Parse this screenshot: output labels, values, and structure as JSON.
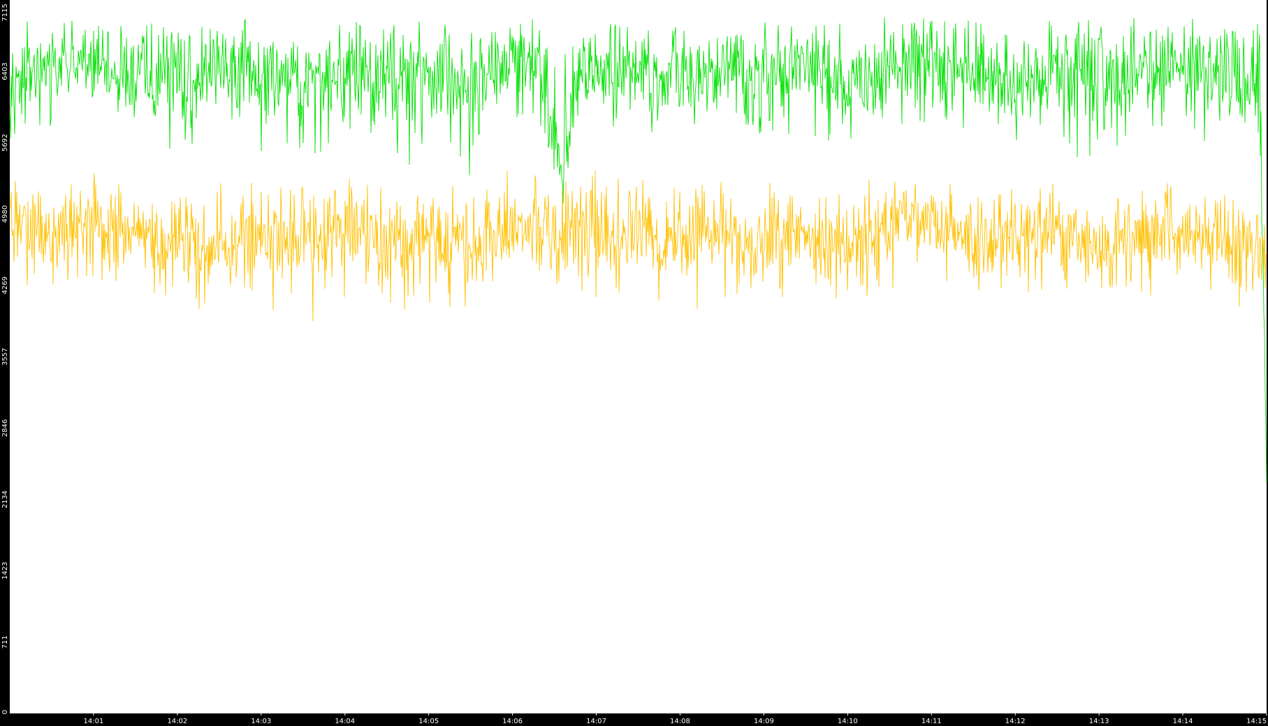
{
  "chart_data": {
    "type": "line",
    "title": "",
    "xlabel": "",
    "ylabel": "",
    "ylim": [
      0,
      7115
    ],
    "xlim": [
      "14:00:00",
      "14:15:00"
    ],
    "grid": false,
    "legend": "none",
    "colors": {
      "background": "#000000",
      "plot_area": "#ffffff",
      "axis_text": "#ffffff"
    },
    "y_ticks": [
      "0",
      "711",
      "1423",
      "2134",
      "2846",
      "3557",
      "4269",
      "4980",
      "5692",
      "6403",
      "7115"
    ],
    "y_tick_values": [
      0,
      711,
      1423,
      2134,
      2846,
      3557,
      4269,
      4980,
      5692,
      6403,
      7115
    ],
    "x_ticks": [
      "14:01",
      "14:02",
      "14:03",
      "14:04",
      "14:05",
      "14:06",
      "14:07",
      "14:08",
      "14:09",
      "14:10",
      "14:11",
      "14:12",
      "14:13",
      "14:14",
      "14:15"
    ],
    "series": [
      {
        "color": "#00e000",
        "x": [
          "14:00:00",
          "14:00:30",
          "14:01:00",
          "14:01:30",
          "14:02:00",
          "14:02:30",
          "14:03:00",
          "14:03:30",
          "14:04:00",
          "14:04:30",
          "14:05:00",
          "14:05:30",
          "14:06:00",
          "14:06:20",
          "14:06:35",
          "14:06:45",
          "14:07:00",
          "14:07:30",
          "14:08:00",
          "14:08:30",
          "14:09:00",
          "14:09:30",
          "14:10:00",
          "14:10:30",
          "14:11:00",
          "14:11:30",
          "14:12:00",
          "14:12:30",
          "14:13:00",
          "14:13:30",
          "14:14:00",
          "14:14:30",
          "14:14:45",
          "14:14:55",
          "14:15:00"
        ],
        "values": [
          6350,
          6420,
          6500,
          6380,
          6300,
          6450,
          6350,
          6280,
          6400,
          6330,
          6450,
          6250,
          6500,
          6400,
          5400,
          6350,
          6450,
          6380,
          6300,
          6420,
          6350,
          6480,
          6300,
          6400,
          6550,
          6350,
          6300,
          6450,
          6350,
          6380,
          6450,
          6320,
          6300,
          6350,
          2300
        ],
        "min": [
          5692,
          5800,
          5900,
          5700,
          5200,
          5750,
          5400,
          5500,
          5700,
          5300,
          5550,
          5350,
          5900,
          5800,
          5000,
          5700,
          5850,
          5700,
          5600,
          5750,
          5650,
          5800,
          5500,
          5700,
          5900,
          5550,
          5600,
          5700,
          5100,
          5650,
          5800,
          5500,
          5450,
          5200,
          2300
        ],
        "max": [
          6900,
          6950,
          7115,
          6900,
          6850,
          6950,
          6900,
          6800,
          6950,
          6850,
          6950,
          6800,
          7000,
          6900,
          6800,
          6900,
          6950,
          6900,
          6850,
          6950,
          6900,
          6950,
          6900,
          6950,
          7100,
          6900,
          6850,
          6950,
          6900,
          7050,
          6950,
          6900,
          6900,
          6950,
          3000
        ]
      },
      {
        "color": "#ffc000",
        "x": [
          "14:00:00",
          "14:00:30",
          "14:01:00",
          "14:01:30",
          "14:02:00",
          "14:02:30",
          "14:03:00",
          "14:03:30",
          "14:04:00",
          "14:04:30",
          "14:05:00",
          "14:05:30",
          "14:06:00",
          "14:06:30",
          "14:07:00",
          "14:07:30",
          "14:08:00",
          "14:08:30",
          "14:09:00",
          "14:09:30",
          "14:10:00",
          "14:10:30",
          "14:11:00",
          "14:11:30",
          "14:12:00",
          "14:12:30",
          "14:13:00",
          "14:13:30",
          "14:14:00",
          "14:14:30",
          "14:14:55",
          "14:15:00"
        ],
        "values": [
          4950,
          4800,
          4900,
          4750,
          4700,
          4650,
          4780,
          4720,
          4850,
          4700,
          4750,
          4650,
          4900,
          4850,
          4800,
          4750,
          4700,
          4800,
          4650,
          4800,
          4700,
          4900,
          4850,
          4750,
          4850,
          4780,
          4700,
          4750,
          4800,
          4700,
          4700,
          4650
        ],
        "min": [
          4300,
          4200,
          4200,
          4300,
          3900,
          4150,
          4050,
          3800,
          4100,
          3850,
          4050,
          3950,
          4300,
          4200,
          4150,
          4050,
          3950,
          4100,
          4100,
          4150,
          4100,
          4200,
          4250,
          4150,
          4200,
          4150,
          4100,
          4150,
          4200,
          4000,
          4000,
          4269
        ],
        "max": [
          5400,
          5350,
          5450,
          5300,
          5250,
          5300,
          5300,
          5250,
          5350,
          5300,
          5300,
          5300,
          5450,
          5350,
          5450,
          5350,
          5300,
          5300,
          5300,
          5300,
          5350,
          5300,
          5300,
          5300,
          5350,
          5300,
          5350,
          5350,
          5400,
          5300,
          5300,
          4700
        ]
      }
    ]
  }
}
